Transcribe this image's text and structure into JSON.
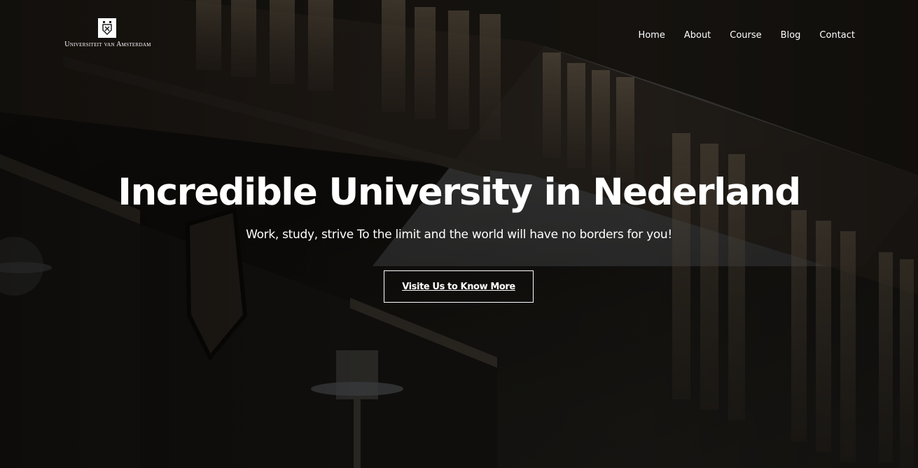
{
  "brand": {
    "logo_text": "Universiteit van Amsterdam",
    "logo_icon": "crest-icon"
  },
  "nav": {
    "items": [
      "Home",
      "About",
      "Course",
      "Blog",
      "Contact"
    ]
  },
  "hero": {
    "title": "Incredible University in Nederland",
    "subtitle": "Work, study, strive To the limit and the world will have no borders for you!",
    "cta_label": "Visite Us to Know More",
    "background_image": "dark-brick-building-with-windows"
  },
  "colors": {
    "text": "#ffffff",
    "overlay": "#000000",
    "button_border": "#ffffff"
  }
}
